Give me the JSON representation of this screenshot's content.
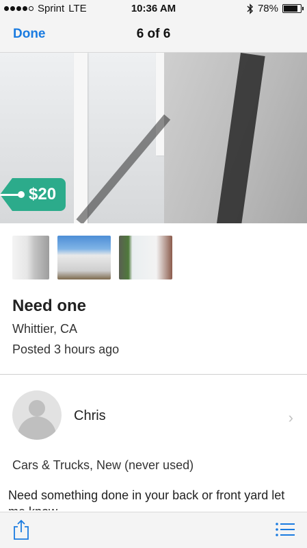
{
  "status_bar": {
    "carrier": "Sprint",
    "network": "LTE",
    "time": "10:36 AM",
    "battery_percent": "78%",
    "battery_level": 0.78,
    "signal_bars": 4
  },
  "nav": {
    "done_label": "Done",
    "title": "6 of 6"
  },
  "listing": {
    "price": "$20",
    "title": "Need one",
    "location": "Whittier, CA",
    "posted": "Posted 3 hours ago",
    "category": "Cars & Trucks, New (never used)",
    "description": "Need something done in your back or front yard let me know"
  },
  "seller": {
    "name": "Chris"
  },
  "colors": {
    "accent": "#1a7be0",
    "price_tag": "#2cab8b"
  },
  "icons": {
    "share": "share-icon",
    "list": "list-icon",
    "chevron": "chevron-right-icon"
  }
}
